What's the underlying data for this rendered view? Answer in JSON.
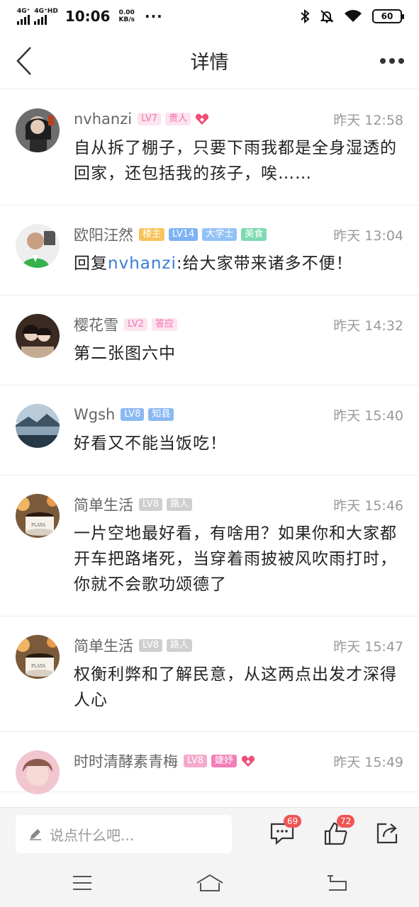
{
  "status": {
    "net1": "4G⁺",
    "net2": "4G⁺HD",
    "time": "10:06",
    "speed_value": "0.00",
    "speed_unit": "KB/s",
    "dots": "···",
    "battery": "60"
  },
  "header": {
    "title": "详情"
  },
  "comments": [
    {
      "name": "nvhanzi",
      "badges": [
        {
          "text": "LV7",
          "color": "#f07ab0",
          "bg": "#fde3ef"
        },
        {
          "text": "贵人",
          "color": "#f06fae",
          "bg": "#fde3ef"
        }
      ],
      "heart": true,
      "time": "昨天 12:58",
      "text": "自从拆了棚子，只要下雨我都是全身湿透的回家，还包括我的孩子，唉……",
      "mention": "",
      "avatar": "avatar-woman-dark"
    },
    {
      "name": "欧阳汪然",
      "badges": [
        {
          "text": "楼主",
          "color": "#ffffff",
          "bg": "#f7c35b"
        },
        {
          "text": "LV14",
          "color": "#ffffff",
          "bg": "#7fb2f5"
        },
        {
          "text": "大学士",
          "color": "#ffffff",
          "bg": "#92c1f6"
        },
        {
          "text": "美食",
          "color": "#ffffff",
          "bg": "#7dd9b0"
        }
      ],
      "heart": false,
      "time": "昨天 13:04",
      "text": ":给大家带来诸多不便！",
      "prefix": "回复",
      "mention": "nvhanzi",
      "avatar": "avatar-man-green"
    },
    {
      "name": "樱花雪",
      "badges": [
        {
          "text": "LV2",
          "color": "#f07ab0",
          "bg": "#fde3ef"
        },
        {
          "text": "答应",
          "color": "#f06fae",
          "bg": "#fde3ef"
        }
      ],
      "heart": false,
      "time": "昨天 14:32",
      "text": "第二张图六中",
      "mention": "",
      "avatar": "avatar-couple"
    },
    {
      "name": "Wgsh",
      "badges": [
        {
          "text": "LV8",
          "color": "#ffffff",
          "bg": "#8ab9f3"
        },
        {
          "text": "知县",
          "color": "#ffffff",
          "bg": "#8ab9f3"
        }
      ],
      "heart": false,
      "time": "昨天 15:40",
      "text": "好看又不能当饭吃！",
      "mention": "",
      "avatar": "avatar-lake"
    },
    {
      "name": "简单生活",
      "badges": [
        {
          "text": "LV8",
          "color": "#ffffff",
          "bg": "#cfcfcf"
        },
        {
          "text": "路人",
          "color": "#ffffff",
          "bg": "#cfcfcf"
        }
      ],
      "heart": false,
      "time": "昨天 15:46",
      "text": "一片空地最好看，有啥用？如果你和大家都开车把路堵死，当穿着雨披被风吹雨打时，你就不会歌功颂德了",
      "mention": "",
      "avatar": "avatar-coffee"
    },
    {
      "name": "简单生活",
      "badges": [
        {
          "text": "LV8",
          "color": "#ffffff",
          "bg": "#cfcfcf"
        },
        {
          "text": "路人",
          "color": "#ffffff",
          "bg": "#cfcfcf"
        }
      ],
      "heart": false,
      "time": "昨天 15:47",
      "text": "权衡利弊和了解民意，从这两点出发才深得人心",
      "mention": "",
      "avatar": "avatar-coffee"
    },
    {
      "name": "时时清酵素青梅",
      "badges": [
        {
          "text": "LV8",
          "color": "#ffffff",
          "bg": "#f5a9cb"
        },
        {
          "text": "婕妤",
          "color": "#ffffff",
          "bg": "#f27fb7"
        }
      ],
      "heart": true,
      "time": "昨天 15:49",
      "text": "",
      "mention": "",
      "avatar": "avatar-pink"
    }
  ],
  "bottom": {
    "placeholder": "说点什么吧...",
    "comment_count": "69",
    "like_count": "72"
  },
  "colors": {
    "accent_pink": "#f05454",
    "mention_blue": "#3a7bd5"
  }
}
